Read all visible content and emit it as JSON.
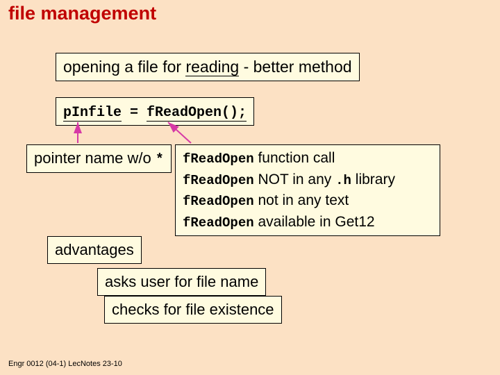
{
  "title": "file management",
  "subtitle_prefix": "opening a file for ",
  "subtitle_underlined": "reading",
  "subtitle_suffix": " - better method",
  "code": {
    "lhs": "pInfile",
    "eq": " = ",
    "rhs": "fReadOpen();"
  },
  "pointer_note": {
    "text": "pointer name w/o ",
    "star": "*"
  },
  "readopen_notes": {
    "fn": "fReadOpen",
    "l1_rest": " function call",
    "l2_mid": " NOT in any ",
    "l2_tail": ".h",
    "l2_end": " library",
    "l3_rest": " not in any text",
    "l4_rest": " available in Get12"
  },
  "advantages": {
    "label": "advantages",
    "a1": "asks user for file name",
    "a2": "checks for file existence"
  },
  "footer": "Engr 0012 (04-1) LecNotes 23-10"
}
